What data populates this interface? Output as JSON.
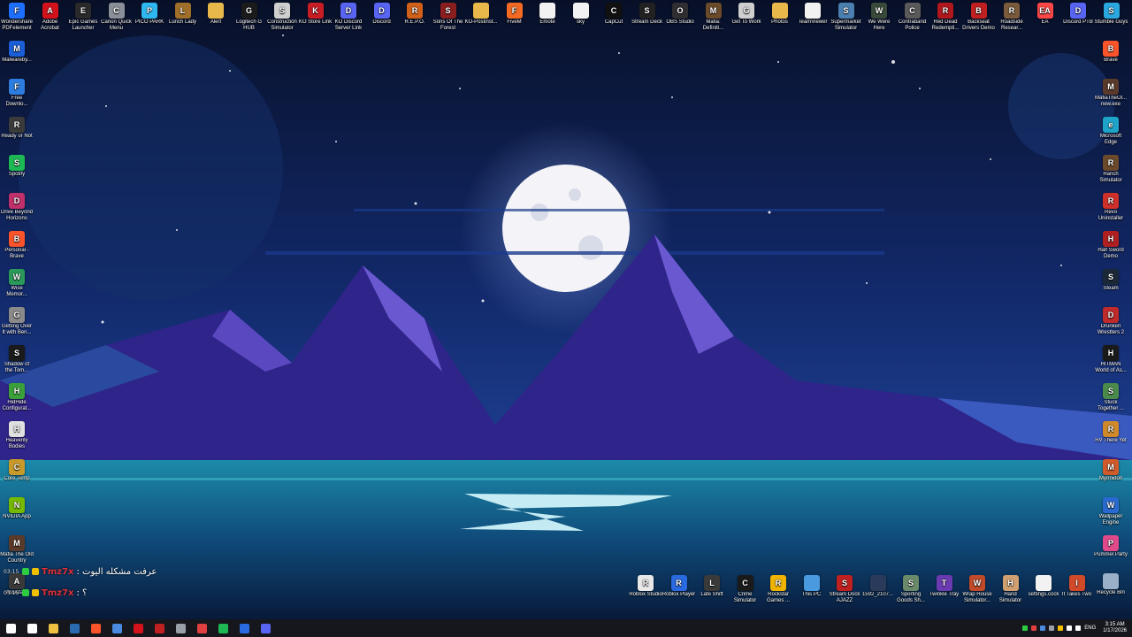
{
  "desktop": {
    "top_icons": [
      {
        "label": "Wondershare PDFelement",
        "icon": "pdfelement-icon",
        "color": "#1e6fff",
        "glyph": "F"
      },
      {
        "label": "Adobe Acrobat",
        "icon": "acrobat-icon",
        "color": "#d4121c",
        "glyph": "A"
      },
      {
        "label": "Epic Games Launcher",
        "icon": "epic-games-icon",
        "color": "#2a2a2a",
        "glyph": "E"
      },
      {
        "label": "Canon Quick Menu",
        "icon": "canon-icon",
        "color": "#8a8f99",
        "glyph": "C"
      },
      {
        "label": "PICO PARK",
        "icon": "pico-park-icon",
        "color": "#2fb8f0",
        "glyph": "P"
      },
      {
        "label": "Lunch Lady",
        "icon": "lunch-lady-icon",
        "color": "#a0702a",
        "glyph": "L"
      },
      {
        "label": "Alert",
        "icon": "folder-icon",
        "color": "#e8b84a",
        "glyph": ""
      },
      {
        "label": "Logitech G HUB",
        "icon": "logitech-icon",
        "color": "#1b1b1b",
        "glyph": "G"
      },
      {
        "label": "Construction Simulator",
        "icon": "construction-icon",
        "color": "#cfcfcf",
        "glyph": "S"
      },
      {
        "label": "KO Store Link",
        "icon": "ko-icon",
        "color": "#c81d25",
        "glyph": "K"
      },
      {
        "label": "KO Discord Server Link",
        "icon": "discord-icon",
        "color": "#5865f2",
        "glyph": "D"
      },
      {
        "label": "Discord",
        "icon": "discord-icon",
        "color": "#5865f2",
        "glyph": "D"
      },
      {
        "label": "R.E.P.O.",
        "icon": "repo-icon",
        "color": "#d0601a",
        "glyph": "R"
      },
      {
        "label": "Sons Of The Forest",
        "icon": "sons-forest-icon",
        "color": "#8b1e1e",
        "glyph": "S"
      },
      {
        "label": "KO-Postinst...",
        "icon": "folder-icon",
        "color": "#e8b84a",
        "glyph": ""
      },
      {
        "label": "FiveM",
        "icon": "fivem-icon",
        "color": "#f36a24",
        "glyph": "F"
      },
      {
        "label": "Emote",
        "icon": "file-icon",
        "color": "#f2f2f2",
        "glyph": ""
      },
      {
        "label": "sky",
        "icon": "file-icon",
        "color": "#f2f2f2",
        "glyph": ""
      },
      {
        "label": "CapCut",
        "icon": "capcut-icon",
        "color": "#111111",
        "glyph": "C"
      },
      {
        "label": "Stream Deck",
        "icon": "stream-deck-icon",
        "color": "#222222",
        "glyph": "S"
      },
      {
        "label": "OBS Studio",
        "icon": "obs-icon",
        "color": "#302e31",
        "glyph": "O"
      },
      {
        "label": "Mafia: Definiti...",
        "icon": "mafia-icon",
        "color": "#6b4a2a",
        "glyph": "M"
      },
      {
        "label": "Get To Work",
        "icon": "get-to-work-icon",
        "color": "#cfcfcf",
        "glyph": "G"
      },
      {
        "label": "Photos",
        "icon": "folder-icon",
        "color": "#e8b84a",
        "glyph": ""
      },
      {
        "label": "TeamViewer",
        "icon": "file-icon",
        "color": "#f2f2f2",
        "glyph": ""
      },
      {
        "label": "Supermarket Simulator",
        "icon": "supermarket-icon",
        "color": "#4a7fb0",
        "glyph": "S"
      },
      {
        "label": "We Were Here",
        "icon": "we-were-here-icon",
        "color": "#3a4a3a",
        "glyph": "W"
      },
      {
        "label": "Contraband Police",
        "icon": "contraband-icon",
        "color": "#5a5a5a",
        "glyph": "C"
      },
      {
        "label": "Red Dead Redempti...",
        "icon": "red-dead-icon",
        "color": "#b0181e",
        "glyph": "R"
      },
      {
        "label": "Backseat Drivers Demo",
        "icon": "backseat-icon",
        "color": "#c02020",
        "glyph": "B"
      },
      {
        "label": "Roadside Resear...",
        "icon": "roadside-icon",
        "color": "#7a5a3a",
        "glyph": "R"
      },
      {
        "label": "EA",
        "icon": "ea-icon",
        "color": "#ff4747",
        "glyph": "EA"
      },
      {
        "label": "Discord PTB",
        "icon": "discord-icon",
        "color": "#5865f2",
        "glyph": "D"
      },
      {
        "label": "Stumble Guys",
        "icon": "stumble-icon",
        "color": "#2aa8e0",
        "glyph": "S"
      }
    ],
    "left_icons": [
      {
        "label": "Malwareby...",
        "icon": "malwarebytes-icon",
        "color": "#1b5fd8",
        "glyph": "M"
      },
      {
        "label": "Free Downlo...",
        "icon": "free-download-icon",
        "color": "#2d7de0",
        "glyph": "F"
      },
      {
        "label": "Ready or Not",
        "icon": "ready-or-not-icon",
        "color": "#3b3b3b",
        "glyph": "R"
      },
      {
        "label": "Spotify",
        "icon": "spotify-icon",
        "color": "#1db954",
        "glyph": "S"
      },
      {
        "label": "Drive Beyond Horizons",
        "icon": "drive-beyond-icon",
        "color": "#c0306a",
        "glyph": "D"
      },
      {
        "label": "Personal - Brave",
        "icon": "brave-icon",
        "color": "#fb542b",
        "glyph": "B"
      },
      {
        "label": "Wise Memor...",
        "icon": "wise-memory-icon",
        "color": "#2a9a5a",
        "glyph": "W"
      },
      {
        "label": "Getting Over It with Ben...",
        "icon": "getting-over-it-icon",
        "color": "#8a8a8a",
        "glyph": "G"
      },
      {
        "label": "Shadow of the Tom...",
        "icon": "shadow-tomb-icon",
        "color": "#1a1a1a",
        "glyph": "S"
      },
      {
        "label": "HidHide Configurat...",
        "icon": "hidhide-icon",
        "color": "#3aa03a",
        "glyph": "H"
      },
      {
        "label": "Heavenly Bodies",
        "icon": "heavenly-bodies-icon",
        "color": "#e0e0e0",
        "glyph": "H"
      },
      {
        "label": "Core Temp",
        "icon": "core-temp-icon",
        "color": "#c89a2a",
        "glyph": "C"
      },
      {
        "label": "NVIDIA App",
        "icon": "nvidia-icon",
        "color": "#76b900",
        "glyph": "N"
      },
      {
        "label": "Mafia The Old Country",
        "icon": "mafia-icon",
        "color": "#5a3a2a",
        "glyph": "M"
      },
      {
        "label": "Assistant",
        "icon": "assistant-icon",
        "color": "#3a3a3a",
        "glyph": "A"
      }
    ],
    "right_icons": [
      {
        "label": "Brave",
        "icon": "brave-icon",
        "color": "#fb542b",
        "glyph": "B"
      },
      {
        "label": "MafiaTheOl... new.exe",
        "icon": "mafia-icon",
        "color": "#5a3a2a",
        "glyph": "M"
      },
      {
        "label": "Microsoft Edge",
        "icon": "edge-icon",
        "color": "#1fa4c9",
        "glyph": "e"
      },
      {
        "label": "Ranch Simulator",
        "icon": "ranch-icon",
        "color": "#6a4a2a",
        "glyph": "R"
      },
      {
        "label": "Revo Uninstaller",
        "icon": "revo-icon",
        "color": "#d0302a",
        "glyph": "R"
      },
      {
        "label": "Half Sword Demo",
        "icon": "half-sword-icon",
        "color": "#b02020",
        "glyph": "H"
      },
      {
        "label": "Steam",
        "icon": "steam-icon",
        "color": "#1b2838",
        "glyph": "S"
      },
      {
        "label": "Drunken Wrestlers 2",
        "icon": "drunken-wrestlers-icon",
        "color": "#c02a2a",
        "glyph": "D"
      },
      {
        "label": "HITMAN World of As...",
        "icon": "hitman-icon",
        "color": "#1a1a1a",
        "glyph": "H"
      },
      {
        "label": "Stuck Together ...",
        "icon": "stuck-together-icon",
        "color": "#4a8a4a",
        "glyph": "S"
      },
      {
        "label": "RV There Yet",
        "icon": "rv-there-yet-icon",
        "color": "#d08a2a",
        "glyph": "R"
      },
      {
        "label": "Myrmidon",
        "icon": "myrmidon-icon",
        "color": "#d05a2a",
        "glyph": "M"
      },
      {
        "label": "Wallpaper Engine",
        "icon": "wallpaper-engine-icon",
        "color": "#2a6ad0",
        "glyph": "W"
      },
      {
        "label": "Pummel Party",
        "icon": "pummel-party-icon",
        "color": "#e04a8a",
        "glyph": "P"
      },
      {
        "label": "Recycle Bin",
        "icon": "recycle-bin-icon",
        "color": "#9ab0c8",
        "glyph": ""
      }
    ],
    "bottom_icons": [
      {
        "label": "Roblox Studio",
        "icon": "roblox-studio-icon",
        "color": "#e8e8e8",
        "glyph": "R"
      },
      {
        "label": "Roblox Player",
        "icon": "roblox-icon",
        "color": "#2a6ae0",
        "glyph": "R"
      },
      {
        "label": "Late Shift",
        "icon": "late-shift-icon",
        "color": "#3a3a3a",
        "glyph": "L"
      },
      {
        "label": "Crime Simulator",
        "icon": "crime-sim-icon",
        "color": "#1a1a1a",
        "glyph": "C"
      },
      {
        "label": "Rockstar Games ...",
        "icon": "rockstar-icon",
        "color": "#f0b400",
        "glyph": "R"
      },
      {
        "label": "This PC",
        "icon": "this-pc-icon",
        "color": "#4a9ae0",
        "glyph": ""
      },
      {
        "label": "Stream Dock AJAZZ",
        "icon": "stream-dock-icon",
        "color": "#c02020",
        "glyph": "S"
      },
      {
        "label": "1592_2107...",
        "icon": "file-icon",
        "color": "#2a3a5a",
        "glyph": ""
      },
      {
        "label": "Sporting Goods Sh...",
        "icon": "sporting-goods-icon",
        "color": "#6a8a6a",
        "glyph": "S"
      },
      {
        "label": "Twinkle Tray",
        "icon": "twinkle-tray-icon",
        "color": "#6a3ab0",
        "glyph": "T"
      },
      {
        "label": "Wrap House Simulator...",
        "icon": "wrap-house-icon",
        "color": "#c04a2a",
        "glyph": "W"
      },
      {
        "label": "Hand Simulator",
        "icon": "hand-sim-icon",
        "color": "#d0a070",
        "glyph": "H"
      },
      {
        "label": "settings.cock",
        "icon": "file-icon",
        "color": "#f2f2f2",
        "glyph": ""
      },
      {
        "label": "It Takes Two",
        "icon": "it-takes-two-icon",
        "color": "#d04a2a",
        "glyph": "I"
      }
    ]
  },
  "chat": {
    "messages": [
      {
        "time": "03:15",
        "user": "Tmz7x",
        "text": ": عرفت مشكله اليوت"
      },
      {
        "time": "03:15",
        "user": "Tmz7x",
        "text": ": ؟"
      }
    ],
    "badge_colors": [
      "#2ecc40",
      "#f0c000"
    ]
  },
  "taskbar": {
    "items": [
      {
        "icon": "windows-start-icon",
        "color": "#ffffff"
      },
      {
        "icon": "search-icon",
        "color": "#ffffff"
      },
      {
        "icon": "file-explorer-icon",
        "color": "#f0c040"
      },
      {
        "icon": "steam-icon",
        "color": "#2a6ab0"
      },
      {
        "icon": "brave-icon",
        "color": "#fb542b"
      },
      {
        "icon": "chrome-icon",
        "color": "#4a8ae0"
      },
      {
        "icon": "acrobat-icon",
        "color": "#d4121c"
      },
      {
        "icon": "obs-icon",
        "color": "#c02020"
      },
      {
        "icon": "settings-icon",
        "color": "#9aa0a8"
      },
      {
        "icon": "app-icon",
        "color": "#e04040"
      },
      {
        "icon": "spotify-icon",
        "color": "#1db954"
      },
      {
        "icon": "app-icon",
        "color": "#2a6ae0"
      },
      {
        "icon": "discord-icon",
        "color": "#5865f2"
      }
    ],
    "language": "ENG",
    "time": "3:15 AM",
    "date": "1/17/2026"
  },
  "colors": {
    "sky_top": "#0a1230",
    "sky_mid": "#1a3a8a",
    "mountain_main": "#3b2a9a",
    "mountain_light": "#6a58d0",
    "water": "#1a7a9a",
    "moon": "#f4f4f8"
  }
}
